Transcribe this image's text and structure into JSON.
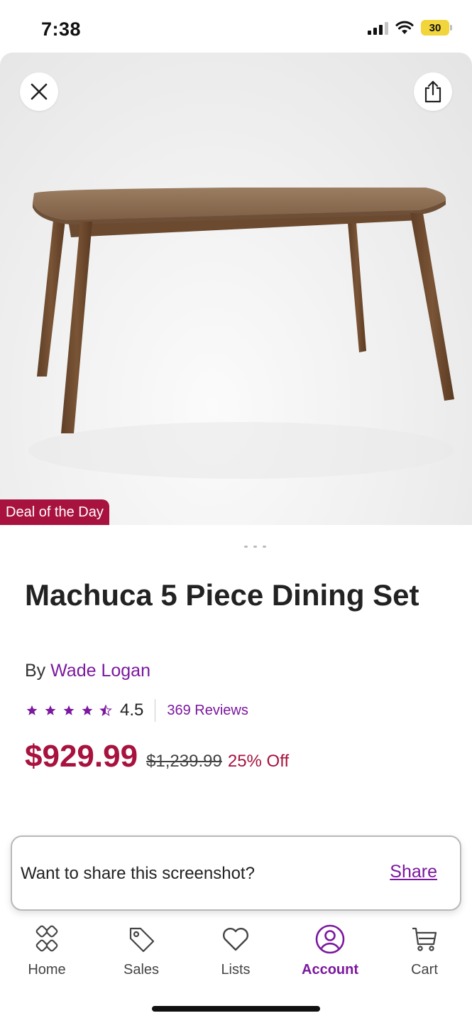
{
  "status_bar": {
    "time": "7:38",
    "battery": "30"
  },
  "product": {
    "badge": "Deal of the Day",
    "title": "Machuca 5 Piece Dining Set",
    "by_prefix": "By",
    "brand": "Wade Logan",
    "rating": "4.5",
    "rating_value": 4.5,
    "reviews": "369 Reviews",
    "price": "$929.99",
    "original_price": "$1,239.99",
    "discount": "25% Off"
  },
  "share_prompt": {
    "text": "Want to share this screenshot?",
    "link": "Share"
  },
  "tabs": [
    {
      "label": "Home",
      "icon": "home-icon",
      "active": false
    },
    {
      "label": "Sales",
      "icon": "tag-icon",
      "active": false
    },
    {
      "label": "Lists",
      "icon": "heart-icon",
      "active": false
    },
    {
      "label": "Account",
      "icon": "account-icon",
      "active": true
    },
    {
      "label": "Cart",
      "icon": "cart-icon",
      "active": false
    }
  ],
  "colors": {
    "accent": "#7b189f",
    "price": "#a8123e",
    "badge": "#a8123e"
  }
}
